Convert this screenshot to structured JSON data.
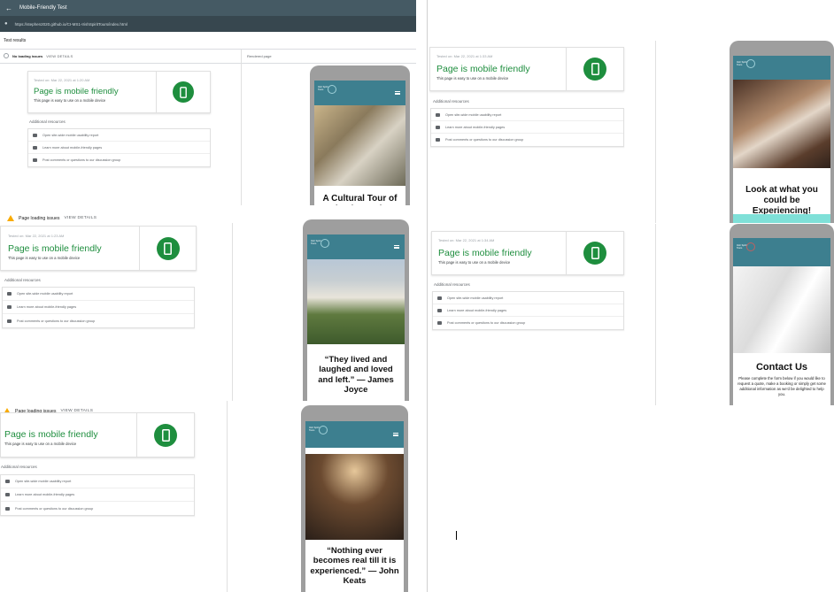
{
  "window": {
    "app_title": "Mobile-Friendly Test",
    "url": "https://stephen2020.github.io/CI-MS1-IrishSpiritTours/index.html",
    "test_results_label": "Test results",
    "no_loading_issues": "No loading issues",
    "view_details": "VIEW DETAILS",
    "rendered_page": "Rendered page"
  },
  "common": {
    "title": "Page is mobile friendly",
    "desc": "This page is easy to use on a mobile device",
    "additional_resources": "Additional resources",
    "resources": [
      "Open site-wide mobile usability report",
      "Learn more about mobile-friendly pages",
      "Post comments or questions to our discussion group"
    ],
    "page_loading_issues": "Page loading issues",
    "view_details": "VIEW DETAILS",
    "logo_text": "Irish Spirit Tours"
  },
  "panels": [
    {
      "tested": "Tested on: Mar 22, 2021 at 1:20 AM",
      "heading": "A Cultural Tour of Ireland's Ancient East"
    },
    {
      "tested": "Tested on: Mar 22, 2021 at 1:23 AM",
      "heading": "“They lived and laughed and loved and left.” — James Joyce"
    },
    {
      "tested": "",
      "heading": "“Nothing ever becomes real till it is experienced.” — John Keats"
    },
    {
      "tested": "Tested on: Mar 22, 2021 at 1:33 AM",
      "heading": "Look at what you could be Experiencing!"
    },
    {
      "tested": "Tested on: Mar 22, 2021 at 1:34 AM",
      "heading": "Contact Us",
      "body": "Please complete the form below if you would like to request a quote, make a booking or simply get some additional information as we'd be delighted to help you."
    }
  ],
  "colors": {
    "accent_green": "#1e8e3e",
    "nav_teal": "#3d7f8f",
    "topbar": "#455a64",
    "warning": "#f9ab00"
  }
}
